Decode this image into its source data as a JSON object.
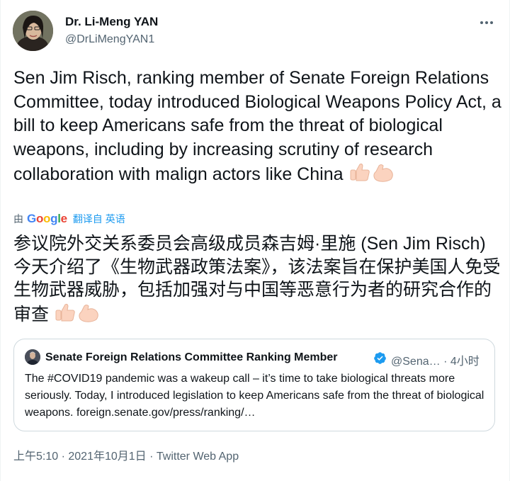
{
  "author": {
    "name": "Dr. Li-Meng YAN",
    "handle": "@DrLiMengYAN1"
  },
  "tweet": {
    "text": "Sen Jim Risch, ranking member of Senate Foreign Relations Committee, today introduced Biological Weapons Policy Act, a bill to keep Americans safe from the threat of biological weapons, including by increasing scrutiny of research collaboration with malign actors like China",
    "emoji": "thumbs-up-and-flexed-biceps"
  },
  "translation": {
    "by_label": "由",
    "provider": "Google",
    "link_label": "翻译自 英语",
    "text": "参议院外交关系委员会高级成员森吉姆·里施 (Sen Jim Risch) 今天介绍了《生物武器政策法案》，该法案旨在保护美国人免受生物武器威胁，包括加强对与中国等恶意行为者的研究合作的审查"
  },
  "quoted_tweet": {
    "name": "Senate Foreign Relations Committee Ranking Member",
    "handle": "@Sena…",
    "time": "· 4小时",
    "text": "The #COVID19 pandemic was a wakeup call – it’s time to take biological threats more seriously. Today, I introduced legislation to keep Americans safe from the threat of biological weapons. foreign.senate.gov/press/ranking/…"
  },
  "meta": {
    "time": "上午5:10",
    "sep1": " · ",
    "date": "2021年10月1日",
    "sep2": " · ",
    "source": "Twitter Web App"
  },
  "icons": {
    "more": "more-options-icon",
    "verified": "verified-badge-icon",
    "translate_logo": "google-logo"
  },
  "colors": {
    "text": "#0f1419",
    "secondary": "#536471",
    "accent": "#1d9bf0",
    "border": "#cfd9de"
  }
}
